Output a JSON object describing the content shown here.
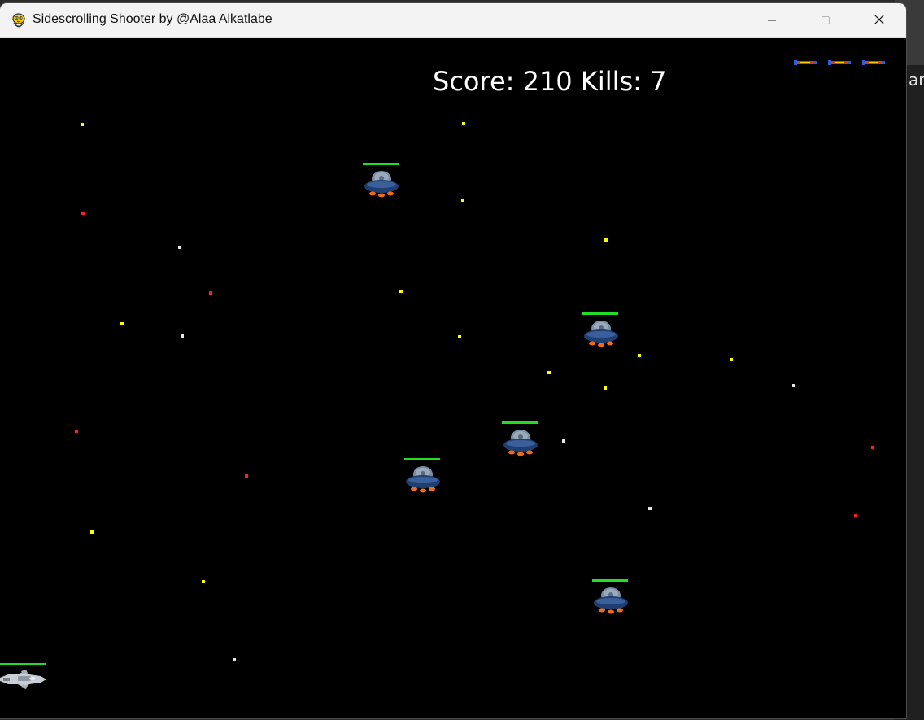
{
  "window": {
    "title": "Sidescrolling Shooter by @Alaa Alkatlabe",
    "app_icon": "pygame-snake-icon",
    "controls": {
      "minimize_icon": "minimize-icon",
      "maximize_icon": "maximize-icon",
      "close_icon": "close-icon"
    }
  },
  "background_window": {
    "partial_text": "an"
  },
  "hud": {
    "score_text": "Score: 210 Kills: 7",
    "lives_count": 3
  },
  "game": {
    "background_color": "#000000",
    "health_bar_color": "#22dd22",
    "star_colors": {
      "yellow": "#ffff00",
      "red": "#ff2020",
      "white": "#e6e6e6"
    },
    "enemy_count": 5,
    "player_health": 1.0,
    "enemy_health": [
      1.0,
      1.0,
      1.0,
      1.0,
      1.0
    ]
  }
}
